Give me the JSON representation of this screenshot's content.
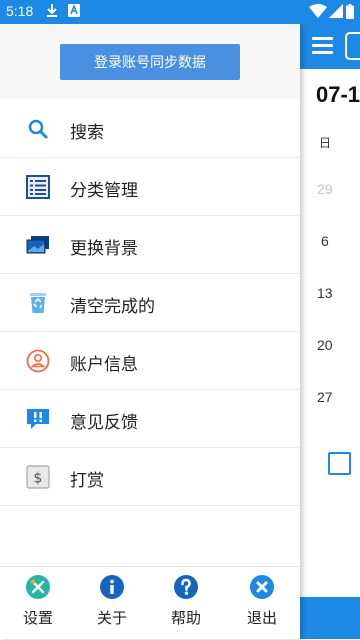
{
  "status_bar": {
    "time": "5:18"
  },
  "drawer": {
    "login_button": "登录账号同步数据",
    "menu_items": [
      {
        "label": "搜索",
        "icon": "search-icon"
      },
      {
        "label": "分类管理",
        "icon": "list-icon"
      },
      {
        "label": "更换背景",
        "icon": "background-icon"
      },
      {
        "label": "清空完成的",
        "icon": "recycle-bin-icon"
      },
      {
        "label": "账户信息",
        "icon": "account-icon"
      },
      {
        "label": "意见反馈",
        "icon": "feedback-icon"
      },
      {
        "label": "打赏",
        "icon": "dollar-icon"
      }
    ],
    "footer": [
      {
        "label": "设置",
        "icon": "settings-icon"
      },
      {
        "label": "关于",
        "icon": "info-icon"
      },
      {
        "label": "帮助",
        "icon": "help-icon"
      },
      {
        "label": "退出",
        "icon": "exit-icon"
      }
    ]
  },
  "background_screen": {
    "date": "07-1",
    "weekday": "日",
    "days": [
      "29",
      "6",
      "13",
      "20",
      "27"
    ]
  },
  "colors": {
    "accent": "#1e88e5",
    "button": "#4a90e2"
  }
}
